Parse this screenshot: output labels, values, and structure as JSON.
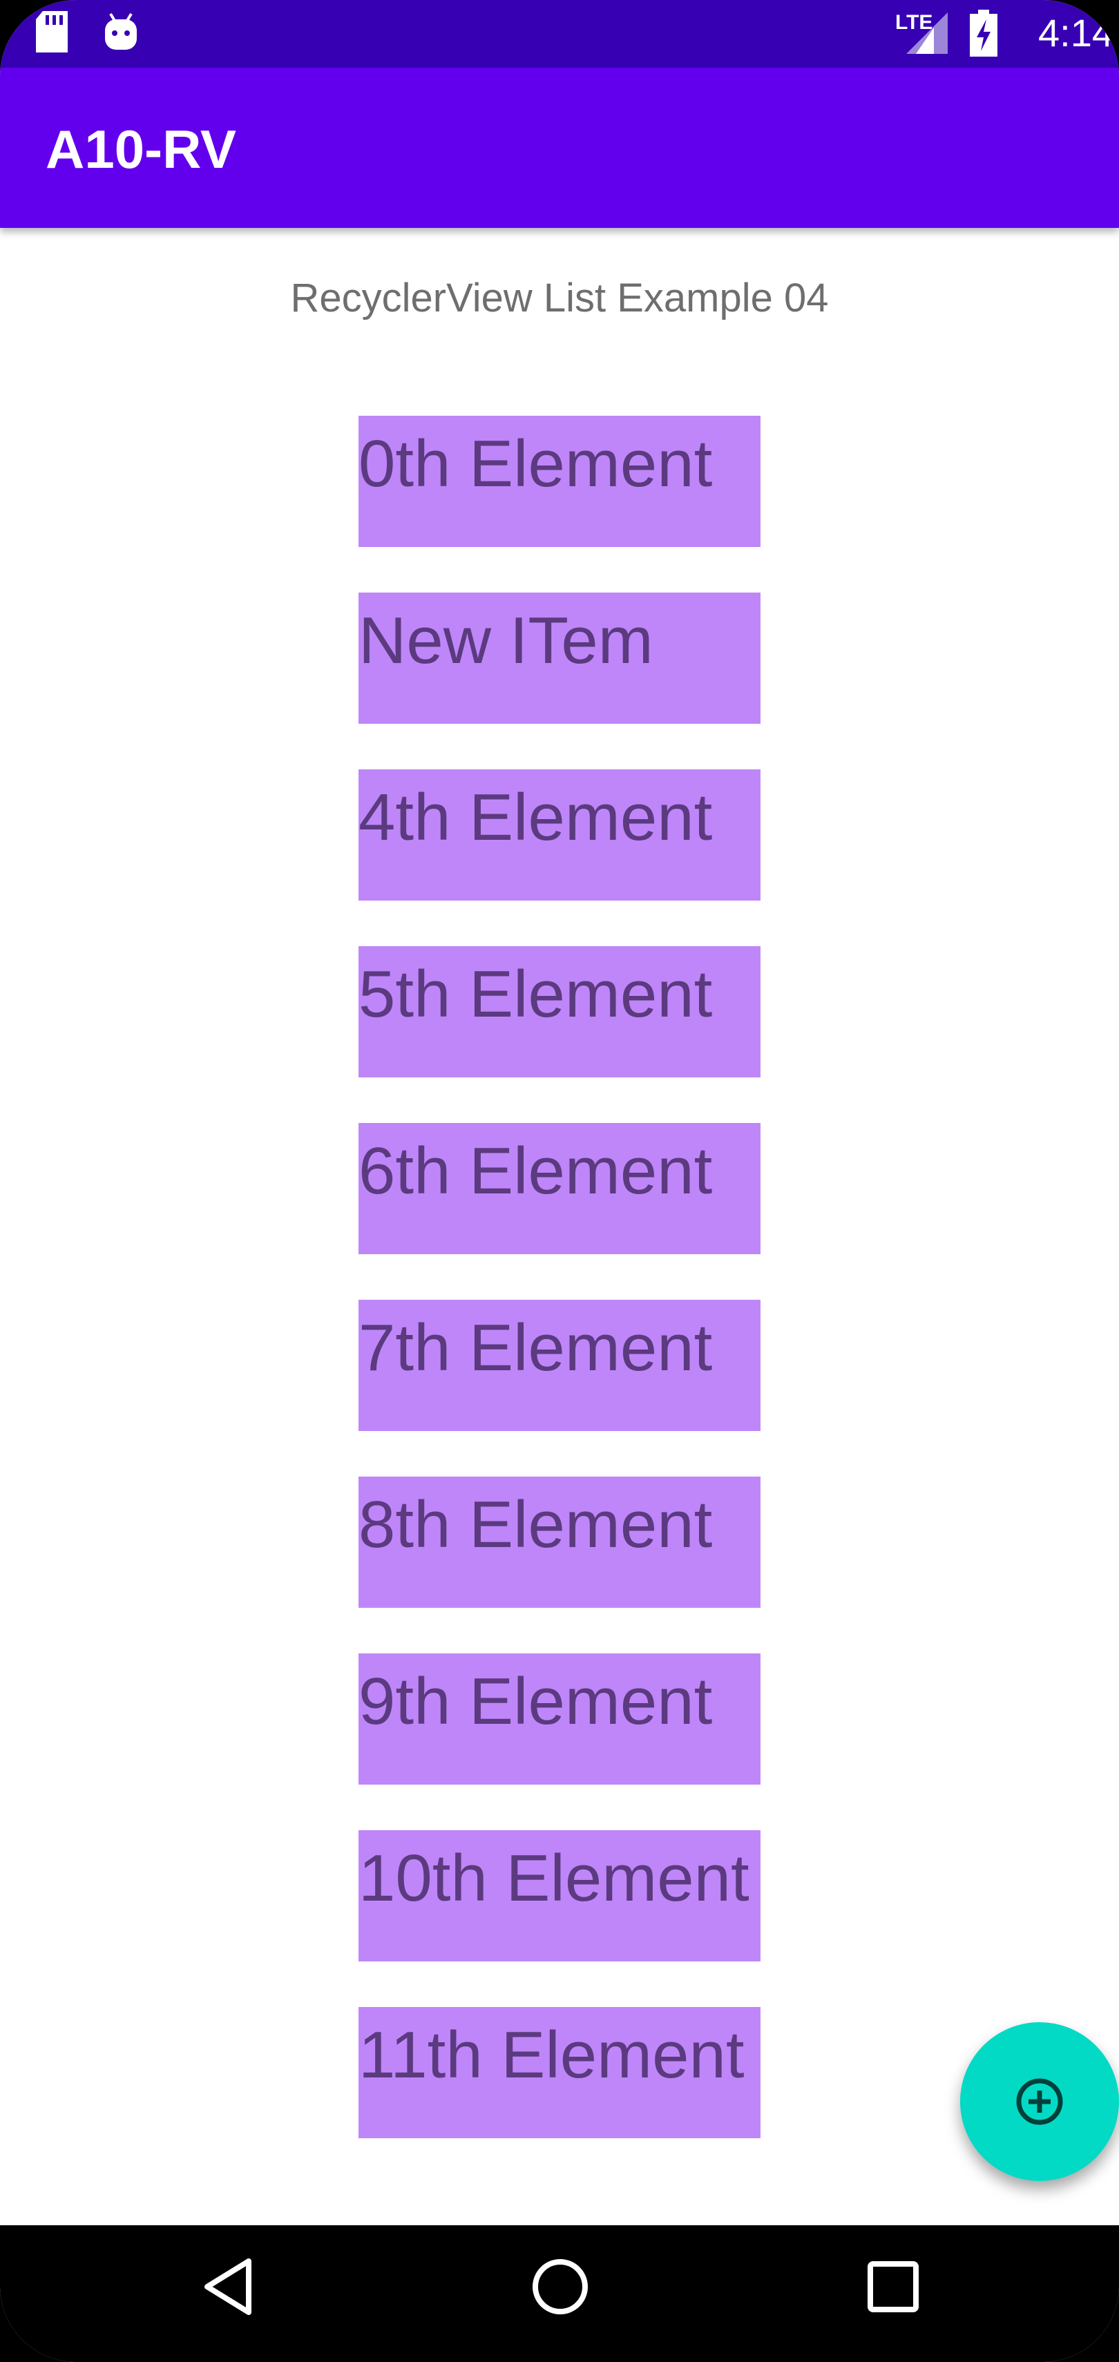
{
  "status_bar": {
    "time": "4:14",
    "network_label": "LTE",
    "icons": [
      "sd-card-icon",
      "android-icon",
      "lte-signal-icon",
      "battery-charging-icon"
    ]
  },
  "app_bar": {
    "title": "A10-RV"
  },
  "content": {
    "subtitle": "RecyclerView List Example 04",
    "items": [
      {
        "label": "0th Element"
      },
      {
        "label": "New ITem"
      },
      {
        "label": "4th Element"
      },
      {
        "label": "5th Element"
      },
      {
        "label": "6th Element"
      },
      {
        "label": "7th Element"
      },
      {
        "label": "8th Element"
      },
      {
        "label": "9th Element"
      },
      {
        "label": "10th Element"
      },
      {
        "label": "11th Element"
      }
    ]
  },
  "fab": {
    "icon": "add-circle-icon"
  },
  "nav_bar": {
    "buttons": [
      "back-icon",
      "home-icon",
      "recents-icon"
    ]
  },
  "colors": {
    "status_bar": "#3700b3",
    "app_bar": "#6200ee",
    "item_background": "#bf86f9",
    "item_text": "#5b3a7f",
    "fab": "#03dac5"
  }
}
